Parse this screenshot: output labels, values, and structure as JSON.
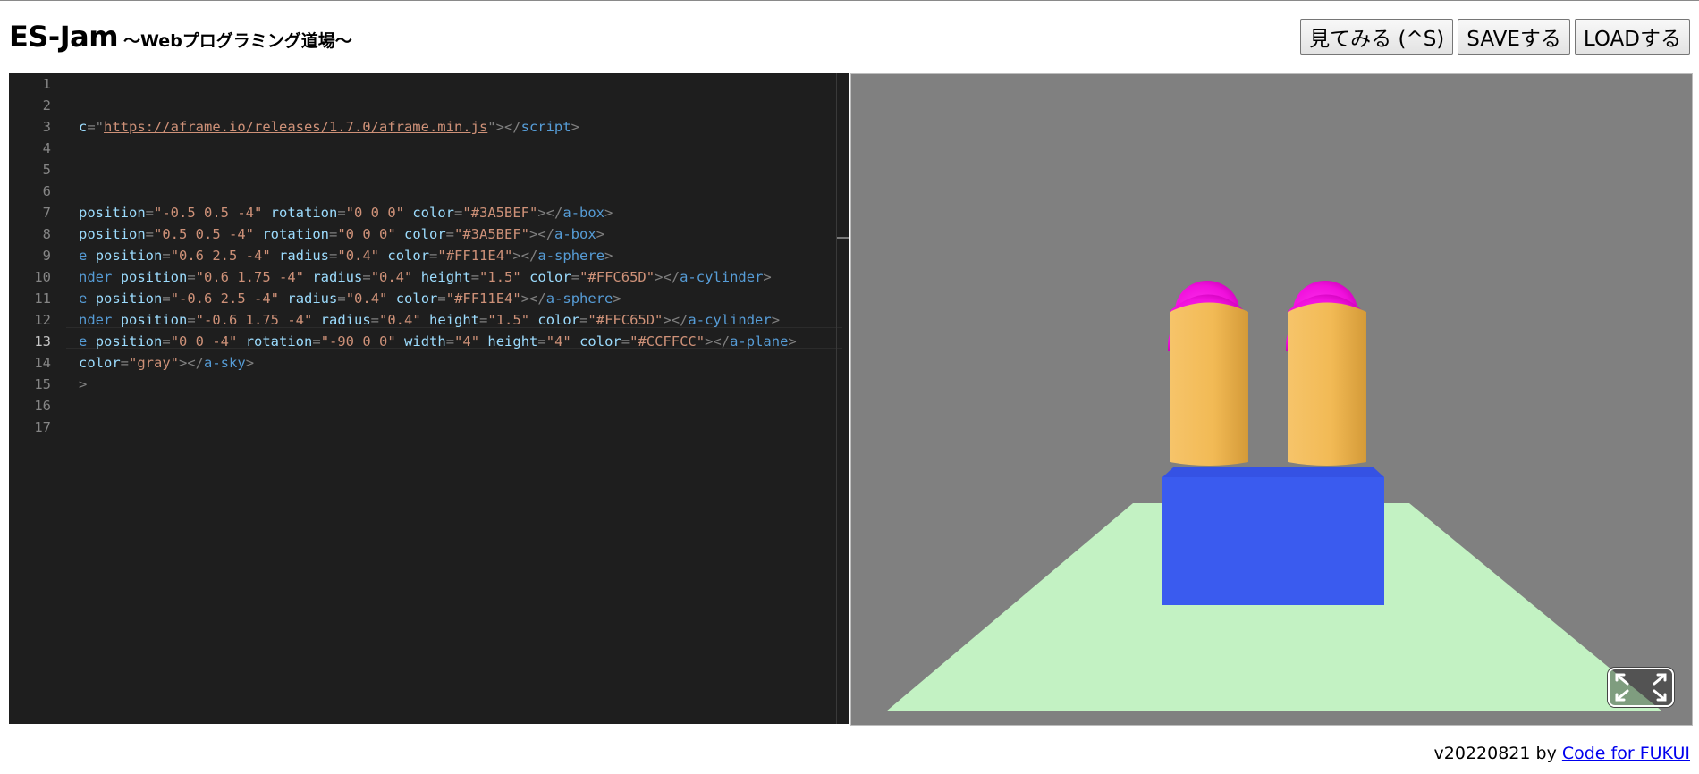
{
  "header": {
    "title": "ES-Jam",
    "subtitle": "〜Webプログラミング道場〜",
    "buttons": {
      "preview": "見てみる (^S)",
      "save": "SAVEする",
      "load": "LOADする"
    }
  },
  "editor": {
    "line_numbers": [
      "1",
      "2",
      "3",
      "4",
      "5",
      "6",
      "7",
      "8",
      "9",
      "10",
      "11",
      "12",
      "13",
      "14",
      "15",
      "16",
      "17"
    ],
    "active_line": "13",
    "lines": {
      "l3": {
        "a1": "c",
        "p1": "=\"",
        "s1": "https://aframe.io/releases/1.7.0/aframe.min.js",
        "p2": "\"></",
        "t1": "script",
        "p3": ">"
      },
      "l7": {
        "a1": "position",
        "s1": "\"-0.5 0.5 -4\"",
        "a2": "rotation",
        "s2": "\"0 0 0\"",
        "a3": "color",
        "s3": "\"#3A5BEF\"",
        "t1": "a-box"
      },
      "l8": {
        "a1": "position",
        "s1": "\"0.5 0.5 -4\"",
        "a2": "rotation",
        "s2": "\"0 0 0\"",
        "a3": "color",
        "s3": "\"#3A5BEF\"",
        "t1": "a-box"
      },
      "l9": {
        "t0": "e",
        "a1": "position",
        "s1": "\"0.6 2.5 -4\"",
        "a2": "radius",
        "s2": "\"0.4\"",
        "a3": "color",
        "s3": "\"#FF11E4\"",
        "t1": "a-sphere"
      },
      "l10": {
        "t0": "nder",
        "a1": "position",
        "s1": "\"0.6 1.75 -4\"",
        "a2": "radius",
        "s2": "\"0.4\"",
        "a3": "height",
        "s3": "\"1.5\"",
        "a4": "color",
        "s4": "\"#FFC65D\"",
        "t1": "a-cylinder"
      },
      "l11": {
        "t0": "e",
        "a1": "position",
        "s1": "\"-0.6 2.5 -4\"",
        "a2": "radius",
        "s2": "\"0.4\"",
        "a3": "color",
        "s3": "\"#FF11E4\"",
        "t1": "a-sphere"
      },
      "l12": {
        "t0": "nder",
        "a1": "position",
        "s1": "\"-0.6 1.75 -4\"",
        "a2": "radius",
        "s2": "\"0.4\"",
        "a3": "height",
        "s3": "\"1.5\"",
        "a4": "color",
        "s4": "\"#FFC65D\"",
        "t1": "a-cylinder"
      },
      "l13": {
        "t0": "e",
        "a1": "position",
        "s1": "\"0 0 -4\"",
        "a2": "rotation",
        "s2": "\"-90 0 0\"",
        "a3": "width",
        "s3": "\"4\"",
        "a4": "height",
        "s4": "\"4\"",
        "a5": "color",
        "s5": "\"#CCFFCC\"",
        "t1": "a-plane"
      },
      "l14": {
        "a1": "color",
        "s1": "\"gray\"",
        "t1": "a-sky"
      },
      "l15": {
        "p1": ">"
      }
    }
  },
  "preview": {
    "sky_color": "#808080",
    "plane_color": "#c3f2c3",
    "box_color": "#3A5BEF",
    "cylinder_color": "#FFC65D",
    "sphere_color": "#FF11E4",
    "fullscreen_icon": "fullscreen-icon"
  },
  "footer": {
    "version": "v20220821 by ",
    "link_label": "Code for FUKUI"
  }
}
